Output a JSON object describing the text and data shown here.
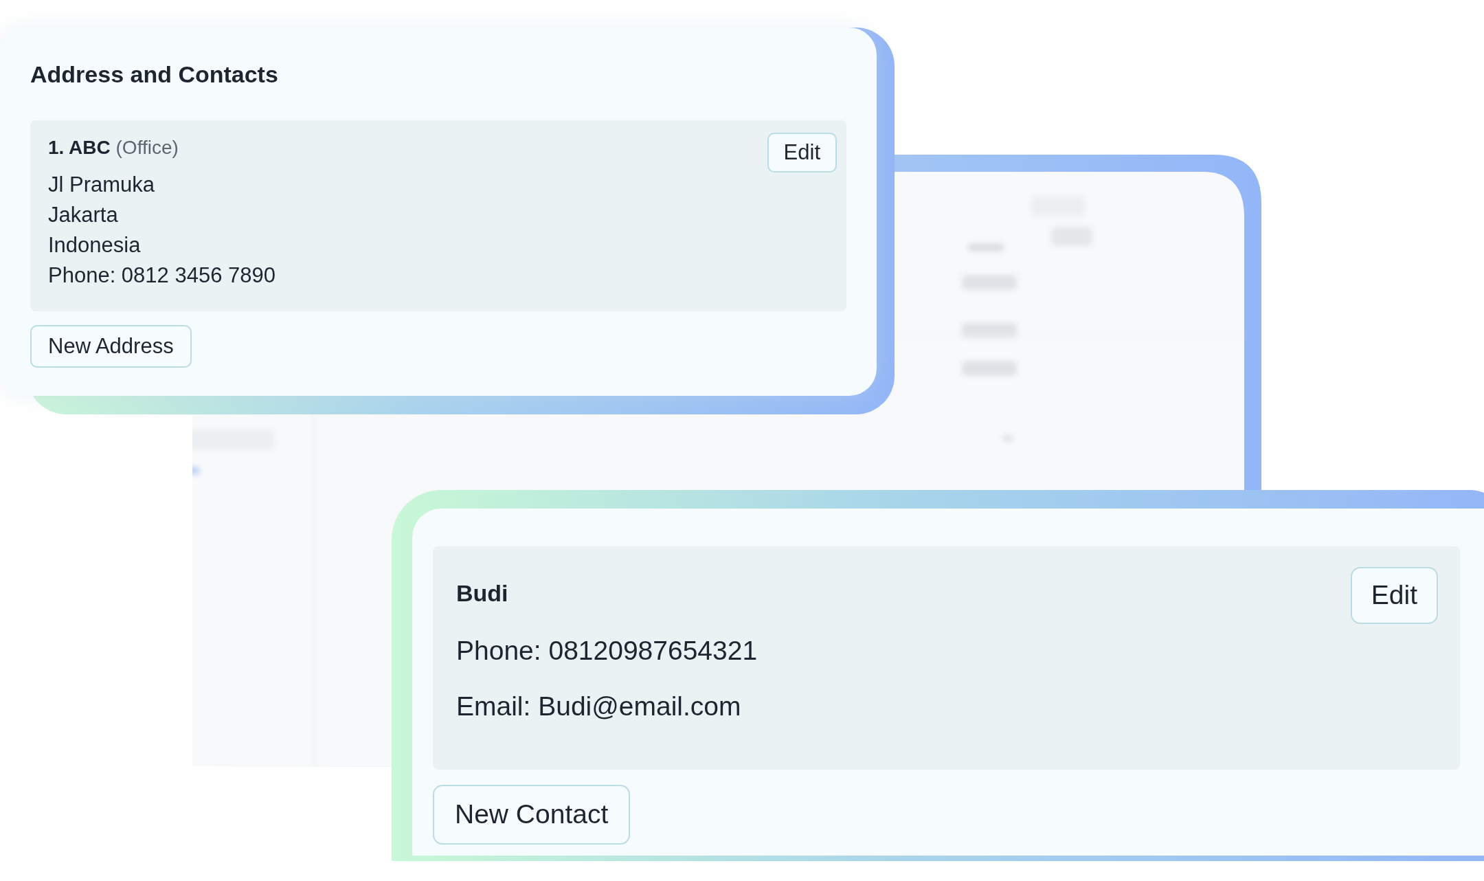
{
  "address_section": {
    "title": "Address and Contacts",
    "addresses": [
      {
        "name": "1. ABC",
        "type": "(Office)",
        "lines": [
          "Jl Pramuka",
          "Jakarta",
          "Indonesia",
          "Phone: 0812 3456 7890"
        ],
        "edit_button": "Edit"
      }
    ],
    "new_button": "New Address"
  },
  "contact_section": {
    "contacts": [
      {
        "name": "Budi",
        "phone": "Phone: 08120987654321",
        "email": "Email: Budi@email.com",
        "edit_button": "Edit"
      }
    ],
    "new_button": "New Contact"
  }
}
